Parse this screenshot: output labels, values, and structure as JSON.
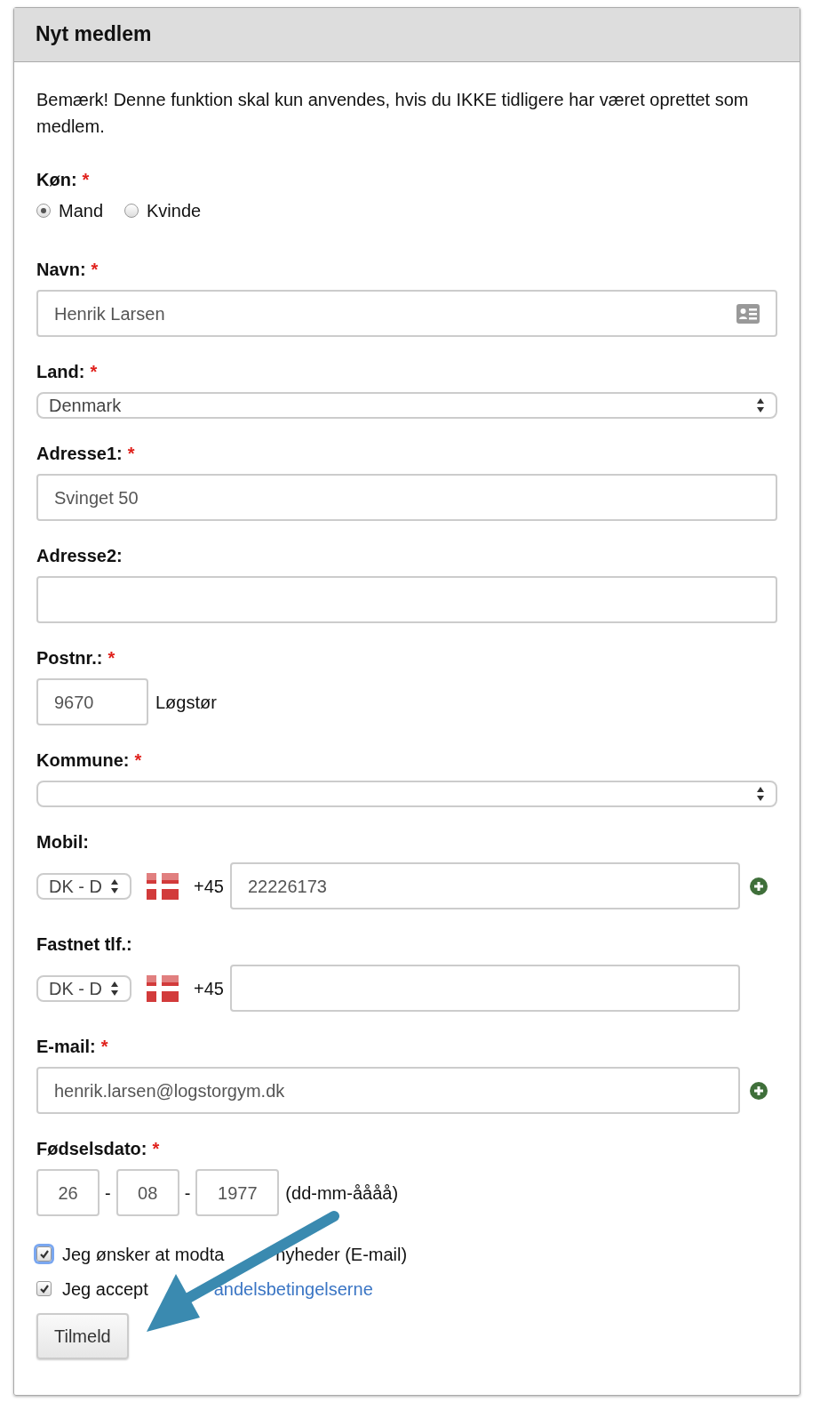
{
  "panel": {
    "title": "Nyt medlem"
  },
  "notice": "Bemærk! Denne funktion skal kun anvendes, hvis du IKKE tidligere har været oprettet som medlem.",
  "fields": [
    {
      "kind": "radio",
      "label": "Køn:",
      "required_mark": "*",
      "options": [
        {
          "label": "Mand",
          "selected": true
        },
        {
          "label": "Kvinde",
          "selected": false
        }
      ]
    },
    {
      "kind": "text",
      "label": "Navn:",
      "required_mark": "*",
      "value": "Henrik Larsen",
      "card_icon": true
    },
    {
      "kind": "select",
      "label": "Land:",
      "required_mark": "*",
      "value": "Denmark"
    },
    {
      "kind": "text",
      "label": "Adresse1:",
      "required_mark": "*",
      "value": "Svinget 50"
    },
    {
      "kind": "text",
      "label": "Adresse2:"
    },
    {
      "kind": "postal",
      "label": "Postnr.:",
      "required_mark": "*",
      "value": "9670",
      "city": "Løgstør"
    },
    {
      "kind": "select",
      "label": "Kommune:",
      "required_mark": "*"
    },
    {
      "kind": "phone",
      "label": "Mobil:",
      "country": "DK - D",
      "prefix": "+45",
      "value": "22226173",
      "add_button": true
    },
    {
      "kind": "phone",
      "label": "Fastnet tlf.:",
      "country": "DK - D",
      "prefix": "+45",
      "add_button": false
    },
    {
      "kind": "email",
      "label": "E-mail:",
      "required_mark": "*",
      "value": "henrik.larsen@logstorgym.dk",
      "add_button": true
    },
    {
      "kind": "date",
      "label": "Fødselsdato:",
      "required_mark": "*",
      "parts": [
        "26",
        "08",
        "1977"
      ],
      "separators": [
        "-",
        "-"
      ],
      "hint": "(dd-mm-åååå)"
    }
  ],
  "checkboxes": [
    {
      "label_parts": [
        "Jeg ønsker at modta",
        "nyheder (E-mail)"
      ],
      "checked": true,
      "focused": true
    },
    {
      "label_parts": [
        "Jeg accept"
      ],
      "link": "andelsbetingelserne",
      "checked": true,
      "focused": false
    }
  ],
  "submit_button": "Tilmeld",
  "annotation": {
    "kind": "arrow"
  }
}
